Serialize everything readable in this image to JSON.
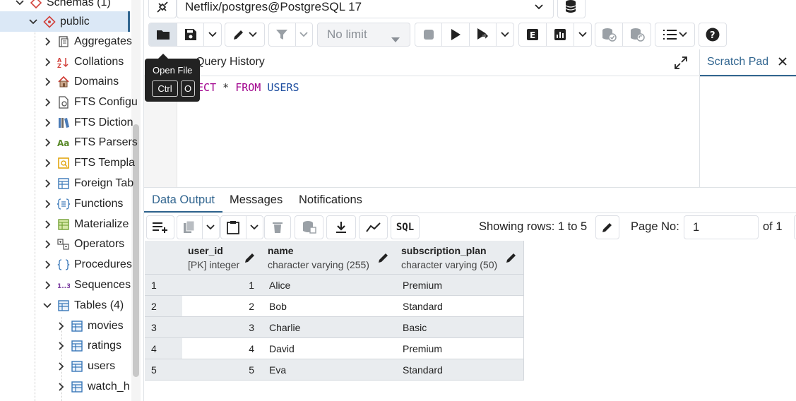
{
  "sidebar": {
    "schemas_label": "Schemas (1)",
    "schema_public": "public",
    "items": [
      {
        "label": "Aggregates"
      },
      {
        "label": "Collations"
      },
      {
        "label": "Domains"
      },
      {
        "label": "FTS Configu"
      },
      {
        "label": "FTS Diction"
      },
      {
        "label": "FTS Parsers"
      },
      {
        "label": "FTS Templa"
      },
      {
        "label": "Foreign Tab"
      },
      {
        "label": "Functions"
      },
      {
        "label": "Materialize"
      },
      {
        "label": "Operators"
      },
      {
        "label": "Procedures"
      },
      {
        "label": "Sequences"
      },
      {
        "label": "Tables (4)"
      }
    ],
    "tables": [
      "movies",
      "ratings",
      "users",
      "watch_h"
    ]
  },
  "connection": {
    "label": "Netflix/postgres@PostgreSQL 17"
  },
  "toolbar": {
    "limit": "No limit"
  },
  "tooltip": {
    "title": "Open File",
    "key1": "Ctrl",
    "key2": "O"
  },
  "editor": {
    "query_history_tab": "Query History",
    "scratch_pad_tab": "Scratch Pad",
    "code_kw1": "LECT",
    "code_star": " * ",
    "code_kw2": "FROM",
    "code_table": "USERS"
  },
  "results": {
    "tabs": [
      "Data Output",
      "Messages",
      "Notifications"
    ],
    "sql_button": "SQL",
    "showing": "Showing rows: 1 to 5",
    "page_label": "Page No:",
    "page_value": "1",
    "of_total": "of 1",
    "columns": [
      {
        "name": "user_id",
        "type": "[PK] integer"
      },
      {
        "name": "name",
        "type": "character varying (255)"
      },
      {
        "name": "subscription_plan",
        "type": "character varying (50)"
      }
    ],
    "rows": [
      {
        "n": "1",
        "user_id": "1",
        "name": "Alice",
        "plan": "Premium"
      },
      {
        "n": "2",
        "user_id": "2",
        "name": "Bob",
        "plan": "Standard"
      },
      {
        "n": "3",
        "user_id": "3",
        "name": "Charlie",
        "plan": "Basic"
      },
      {
        "n": "4",
        "user_id": "4",
        "name": "David",
        "plan": "Premium"
      },
      {
        "n": "5",
        "user_id": "5",
        "name": "Eva",
        "plan": "Standard"
      }
    ]
  },
  "colors": {
    "accent": "#326690",
    "keyword": "#a0008c",
    "identifier": "#1f4fa0",
    "selected_row": "#dbe8f6"
  }
}
